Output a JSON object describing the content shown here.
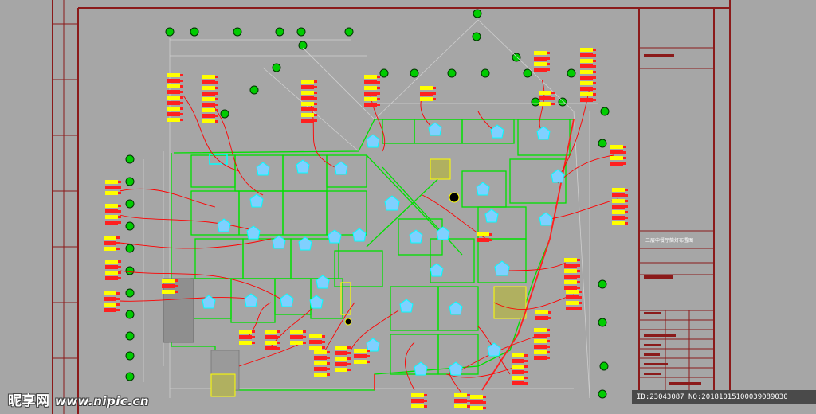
{
  "drawing": {
    "title": "二层中餐厅筒灯布置图"
  },
  "watermark": {
    "brand": "昵享网",
    "site": "www.nipic.cn"
  },
  "image_id": {
    "text": "ID:23043087 NO:20181015100039089030"
  },
  "colors": {
    "background": "#a6a6a6",
    "frame": "#8b1a1a",
    "walls": "#00e000",
    "fixtures": "#00ffff",
    "leaders": "#ff0000",
    "tags_yellow": "#ffff00",
    "tags_red": "#ff2020",
    "grid_markers": "#00cc00"
  }
}
